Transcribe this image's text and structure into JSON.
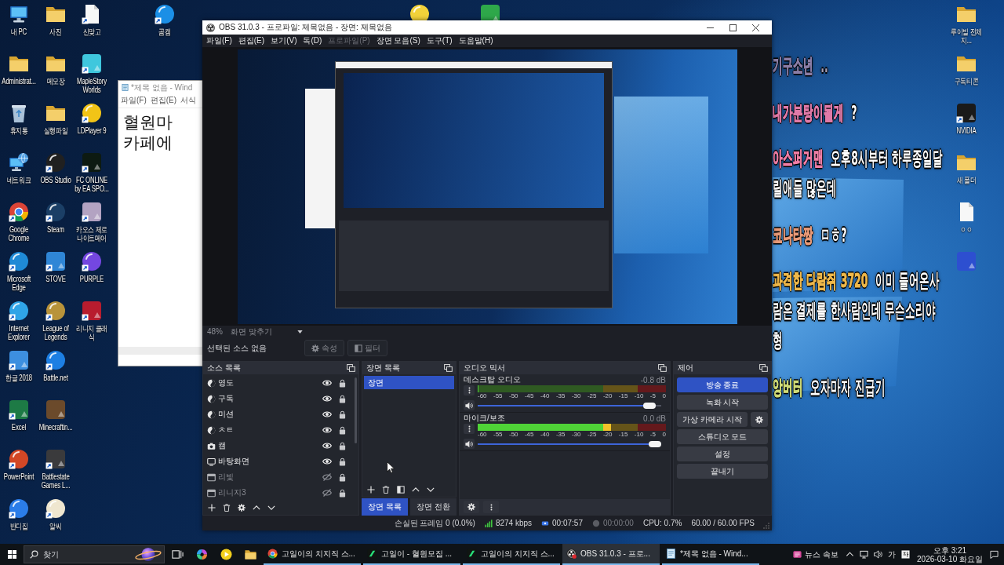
{
  "desktop": {
    "icon_columns": [
      [
        {
          "label": "내 PC",
          "kind": "monitor",
          "shortcut": false
        },
        {
          "label": "Administrat...",
          "kind": "folder",
          "shortcut": false
        },
        {
          "label": "휴지통",
          "kind": "recycle-bin",
          "shortcut": false
        },
        {
          "label": "네트워크",
          "kind": "network",
          "shortcut": false
        },
        {
          "label": "Google Chrome",
          "kind": "browser",
          "shortcut": true
        },
        {
          "label": "Microsoft Edge",
          "kind": "round-app",
          "color": "#1f8ad6",
          "shortcut": true
        },
        {
          "label": "Internet Explorer",
          "kind": "round-app",
          "color": "#2fa4e7",
          "shortcut": true
        },
        {
          "label": "한글 2018",
          "kind": "tile-app",
          "color": "#3d8fe0",
          "shortcut": true
        },
        {
          "label": "Excel",
          "kind": "tile-app",
          "color": "#1d7a45",
          "shortcut": true
        },
        {
          "label": "PowerPoint",
          "kind": "round-app",
          "color": "#d24726",
          "shortcut": true
        },
        {
          "label": "반디집",
          "kind": "round-app",
          "color": "#2b7de9",
          "shortcut": true
        }
      ],
      [
        {
          "label": "사진",
          "kind": "folder",
          "shortcut": false
        },
        {
          "label": "메모장",
          "kind": "folder",
          "shortcut": false
        },
        {
          "label": "실행파일",
          "kind": "folder",
          "shortcut": false
        },
        {
          "label": "OBS Studio",
          "kind": "round-app",
          "color": "#202020",
          "shortcut": true
        },
        {
          "label": "Steam",
          "kind": "round-app",
          "color": "#1b3f66",
          "shortcut": true
        },
        {
          "label": "STOVE",
          "kind": "tile-app",
          "color": "#2f86d6",
          "shortcut": true
        },
        {
          "label": "League of Legends",
          "kind": "round-app",
          "color": "#b8933a",
          "shortcut": true
        },
        {
          "label": "Battle.net",
          "kind": "round-app",
          "color": "#1d7fe3",
          "shortcut": true
        },
        {
          "label": "Minecraftin...",
          "kind": "tile-app",
          "color": "#6b4a2b",
          "shortcut": false
        },
        {
          "label": "Battlestate Games L...",
          "kind": "tile-app",
          "color": "#3a3a3c",
          "shortcut": true
        },
        {
          "label": "알씨",
          "kind": "round-app",
          "color": "#efe6cf",
          "shortcut": true
        }
      ],
      [
        {
          "label": "신맞고",
          "kind": "document",
          "shortcut": true
        },
        {
          "label": "MapleStory Worlds",
          "kind": "tile-app",
          "color": "#3fc7dd",
          "shortcut": true
        },
        {
          "label": "LDPlayer 9",
          "kind": "round-app",
          "color": "#f2c417",
          "shortcut": true
        },
        {
          "label": "FC ONLINE by EA SPO...",
          "kind": "tile-app",
          "color": "#0d1a12",
          "shortcut": true
        },
        {
          "label": "카오스 제로 나이트메어",
          "kind": "tile-app",
          "color": "#b3a3c2",
          "shortcut": true
        },
        {
          "label": "PURPLE",
          "kind": "round-app",
          "color": "#7447e0",
          "shortcut": true
        },
        {
          "label": "리니지 클래식",
          "kind": "tile-app",
          "color": "#b81c2e",
          "shortcut": true
        }
      ],
      [
        {
          "label": "곰캠",
          "kind": "round-app",
          "color": "#1b8fe6",
          "shortcut": true
        }
      ]
    ],
    "right_icons": [
      {
        "label": "루이빌 전체지...",
        "kind": "folder",
        "shortcut": false
      },
      {
        "label": "구독티콘",
        "kind": "folder",
        "shortcut": false
      },
      {
        "label": "NVIDIA",
        "kind": "tile-app",
        "color": "#1a1a1a",
        "shortcut": true
      },
      {
        "label": "새 폴더",
        "kind": "folder",
        "shortcut": false
      },
      {
        "label": "ㅇㅇ",
        "kind": "document",
        "shortcut": false
      },
      {
        "kind": "tile-app",
        "color": "#2d4fd0",
        "shortcut": false
      }
    ],
    "covered_icons": [
      {
        "kind": "round-app",
        "color": "#f3d23a",
        "shortcut": false
      },
      {
        "kind": "tile-app",
        "color": "#2ea84a",
        "shortcut": false
      }
    ]
  },
  "notepad": {
    "title": "*제목 없음 - Wind",
    "menu": [
      "파일(F)",
      "편집(E)",
      "서식"
    ],
    "lines": [
      "혈원마",
      "카페에"
    ]
  },
  "chat": [
    {
      "name": "기구소년",
      "message": "..",
      "color": "#8a7da6",
      "faded": true
    },
    {
      "name": "내가분탕이될게",
      "message": "?",
      "color": "#e07aa8",
      "faded": false
    },
    {
      "name": "아스퍼거맨",
      "message": "오후8시부터 하루종일달릴애들 많은데",
      "color": "#f07ea6",
      "faded": false
    },
    {
      "name": "코나타짱",
      "message": "ㅁㅎ?",
      "color": "#e89a78",
      "faded": false
    },
    {
      "name": "과격한 다람쥐 3720",
      "message": "이미 들어온사람은 결제를 한사람인데 무슨소리야 형",
      "color": "#efb84a",
      "faded": false
    },
    {
      "name": "앙버터",
      "message": "오자마자 진급기",
      "color": "#cfdc78",
      "faded": false
    }
  ],
  "obs": {
    "title": "OBS 31.0.3 - 프로파일: 제목없음 - 장면: 제목없음",
    "menu": [
      {
        "label": "파일(F)",
        "disabled": false
      },
      {
        "label": "편집(E)",
        "disabled": false
      },
      {
        "label": "보기(V)",
        "disabled": false
      },
      {
        "label": "독(D)",
        "disabled": false
      },
      {
        "label": "프로파일(P)",
        "disabled": true
      },
      {
        "label": "장면 모음(S)",
        "disabled": false
      },
      {
        "label": "도구(T)",
        "disabled": false
      },
      {
        "label": "도움말(H)",
        "disabled": false
      }
    ],
    "preview": {
      "zoom": "48%",
      "scale_mode": "화면 맞추기"
    },
    "context_bar": {
      "label": "선택된 소스 없음",
      "buttons": [
        {
          "label": "속성",
          "kind": "properties",
          "disabled": true
        },
        {
          "label": "필터",
          "kind": "filters",
          "disabled": true
        }
      ]
    },
    "sources": {
      "title": "소스 목록",
      "items": [
        {
          "name": "영도",
          "kind": "browser",
          "visible": true
        },
        {
          "name": "구독",
          "kind": "browser",
          "visible": true
        },
        {
          "name": "미션",
          "kind": "browser",
          "visible": true
        },
        {
          "name": "ㅊㅌ",
          "kind": "browser",
          "visible": true
        },
        {
          "name": "캠",
          "kind": "camera",
          "visible": true
        },
        {
          "name": "바탕화면",
          "kind": "display",
          "visible": true
        },
        {
          "name": "리빛",
          "kind": "window",
          "visible": false
        },
        {
          "name": "리니지3",
          "kind": "window",
          "visible": false
        }
      ]
    },
    "scenes": {
      "title": "장면 목록",
      "items": [
        {
          "name": "장면",
          "selected": true
        }
      ]
    },
    "dock_tabs": [
      {
        "label": "장면 목록",
        "selected": true
      },
      {
        "label": "장면 전환",
        "selected": false
      }
    ],
    "mixer": {
      "title": "오디오 믹서",
      "channels": [
        {
          "name": "데스크탑 오디오",
          "reading": "-0.8 dB",
          "meter": {
            "level": 0
          },
          "scale": [
            "-60",
            "-55",
            "-50",
            "-45",
            "-40",
            "-35",
            "-30",
            "-25",
            "-20",
            "-15",
            "-10",
            "-5",
            "0"
          ],
          "fader": {
            "level": 0.97
          }
        },
        {
          "name": "마이크/보조",
          "reading": "0.0 dB",
          "meter": {
            "level": 0.71
          },
          "scale": [
            "-60",
            "-55",
            "-50",
            "-45",
            "-40",
            "-35",
            "-30",
            "-25",
            "-20",
            "-15",
            "-10",
            "-5",
            "0"
          ],
          "fader": {
            "level": 1
          }
        }
      ]
    },
    "controls": {
      "title": "제어",
      "buttons": [
        {
          "label": "방송 종료",
          "active": true,
          "settings": false
        },
        {
          "label": "녹화 시작",
          "active": false,
          "settings": false
        },
        {
          "label": "가상 카메라 시작",
          "active": false,
          "settings": true
        },
        {
          "label": "스튜디오 모드",
          "active": false,
          "settings": false
        },
        {
          "label": "설정",
          "active": false,
          "settings": false
        },
        {
          "label": "끝내기",
          "active": false,
          "settings": false
        }
      ]
    },
    "status_bar": {
      "dropped_frames": "손실된 프레임 0 (0.0%)",
      "bitrate": "8274 kbps",
      "stream_time": "00:07:57",
      "streaming": true,
      "record_time": "00:00:00",
      "recording": false,
      "cpu": "CPU: 0.7%",
      "fps": "60.00 / 60.00 FPS"
    }
  },
  "taskbar": {
    "search": {
      "placeholder": "찾기"
    },
    "pinned": [
      {
        "kind": "task-view"
      },
      {
        "kind": "assistant"
      },
      {
        "kind": "player"
      },
      {
        "kind": "folder"
      }
    ],
    "tasks": [
      {
        "label": "고일이의 치지직 스...",
        "kind": "browser",
        "selected": false
      },
      {
        "label": "고일이 - 혈원모집 ...",
        "kind": "streaming",
        "selected": false
      },
      {
        "label": "고일이의 치지직 스...",
        "kind": "streaming",
        "selected": false
      },
      {
        "label": "OBS 31.0.3 - 프로...",
        "kind": "recorder",
        "selected": true
      },
      {
        "label": "*제목 없음 - Wind...",
        "kind": "editor",
        "selected": false
      }
    ],
    "tray": {
      "news": "뉴스 속보",
      "ime": "가",
      "time": "오후 3:21",
      "date": "2026-03-10 화요일"
    }
  }
}
